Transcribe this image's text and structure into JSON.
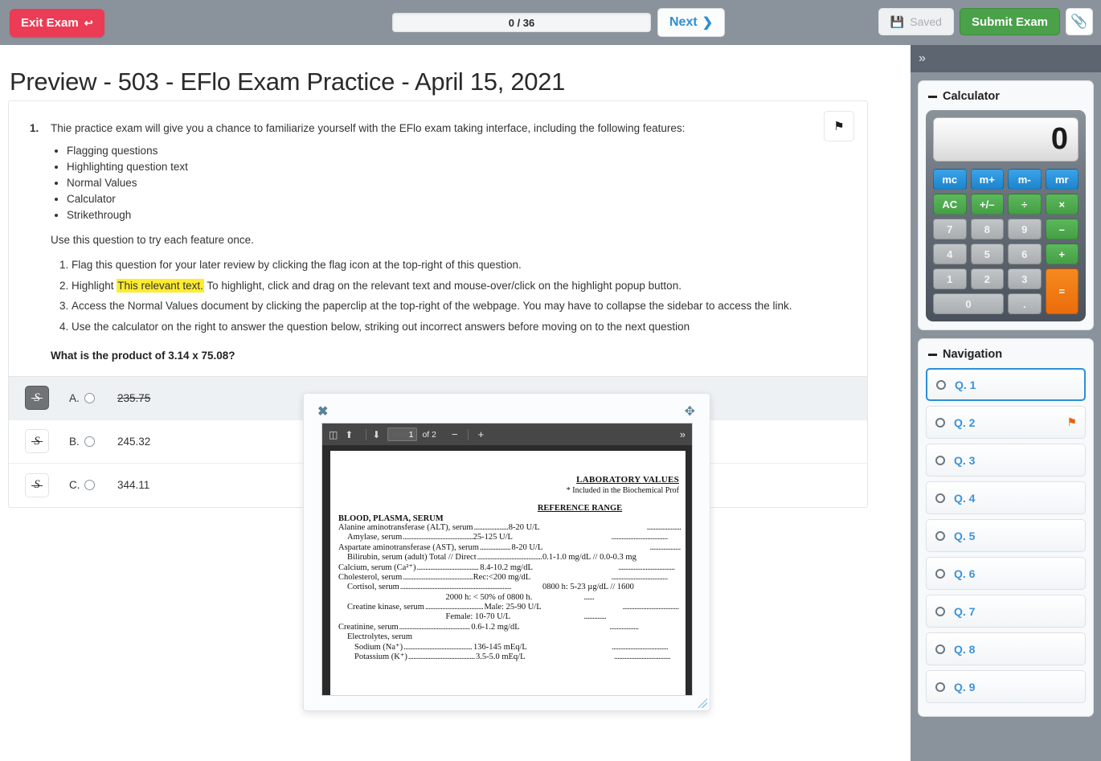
{
  "topbar": {
    "exit_label": "Exit Exam",
    "exit_icon": "exit-arrow-icon",
    "progress_text": "0 / 36",
    "next_label": "Next",
    "next_icon": "chevron-right-icon",
    "saved_label": "Saved",
    "save_icon": "floppy-disk-icon",
    "submit_label": "Submit Exam",
    "paperclip_icon": "paperclip-icon",
    "exit_color": "#ec3b55",
    "submit_color": "#4aa14a",
    "bar_color": "#8a939b"
  },
  "page": {
    "title": "Preview - 503 - EFlo Exam Practice - April 15, 2021"
  },
  "question": {
    "number": "1.",
    "stem": "Thie practice exam will give you a chance to familiarize yourself with the EFlo exam taking interface, including the following features:",
    "features": [
      "Flagging questions",
      "Highlighting question text",
      "Normal Values",
      "Calculator",
      "Strikethrough"
    ],
    "use_line": "Use this question to try each feature once.",
    "steps": [
      {
        "pre": "Flag this question for your later review by clicking the flag icon at the top-right of this question.",
        "highlight": "",
        "post": ""
      },
      {
        "pre": "Highlight ",
        "highlight": "This relevant text.",
        "post": " To highlight, click and drag on the relevant text and mouse-over/click on the highlight popup button."
      },
      {
        "pre": "Access the Normal Values document by clicking the paperclip at the top-right of the webpage. You may have to collapse the sidebar to access the link.",
        "highlight": "",
        "post": ""
      },
      {
        "pre": "Use the calculator on the right to answer the question below, striking out incorrect answers before moving on to the next question",
        "highlight": "",
        "post": ""
      }
    ],
    "prompt": "What is the product of 3.14 x 75.08?",
    "flag_icon": "flag-icon",
    "options": [
      {
        "letter": "A.",
        "value": "235.75",
        "struck": true
      },
      {
        "letter": "B.",
        "value": "245.32",
        "struck": false
      },
      {
        "letter": "C.",
        "value": "344.11",
        "struck": false
      }
    ],
    "strike_glyph": "S"
  },
  "sidebar": {
    "collapse_icon": "chevron-double-right-icon",
    "calculator": {
      "title": "Calculator",
      "display": "0",
      "memory_keys": [
        "mc",
        "m+",
        "m-",
        "mr"
      ],
      "op_keys": [
        "AC",
        "+/–",
        "÷",
        "×"
      ],
      "row1": [
        "7",
        "8",
        "9",
        "–"
      ],
      "row2": [
        "4",
        "5",
        "6",
        "+"
      ],
      "row3": [
        "1",
        "2",
        "3"
      ],
      "row4": [
        "0",
        "."
      ],
      "equals": "=",
      "colors": {
        "memory": "#2e97dd",
        "operator": "#5cb85c",
        "digit": "#b6babd",
        "equals": "#ee7010"
      }
    },
    "navigation": {
      "title": "Navigation",
      "items": [
        {
          "label": "Q. 1",
          "active": true,
          "flagged": false
        },
        {
          "label": "Q. 2",
          "active": false,
          "flagged": true
        },
        {
          "label": "Q. 3",
          "active": false,
          "flagged": false
        },
        {
          "label": "Q. 4",
          "active": false,
          "flagged": false
        },
        {
          "label": "Q. 5",
          "active": false,
          "flagged": false
        },
        {
          "label": "Q. 6",
          "active": false,
          "flagged": false
        },
        {
          "label": "Q. 7",
          "active": false,
          "flagged": false
        },
        {
          "label": "Q. 8",
          "active": false,
          "flagged": false
        },
        {
          "label": "Q. 9",
          "active": false,
          "flagged": false
        }
      ],
      "flag_icon": "flag-icon",
      "active_color": "#2c8fd8"
    }
  },
  "pdf_popup": {
    "close_icon": "close-icon",
    "move_icon": "move-handle-icon",
    "toolbar": {
      "sidebar_icon": "toggle-sidebar-icon",
      "up_icon": "arrow-up-icon",
      "down_icon": "arrow-down-icon",
      "page_number": "1",
      "page_total": "of 2",
      "zoom_out": "−",
      "zoom_in": "+",
      "more_icon": "chevron-double-right-icon"
    },
    "document": {
      "title": "LABORATORY VALUES",
      "subtitle": "*  Included in the Biochemical Prof",
      "reference_header": "REFERENCE RANGE",
      "section": "BLOOD, PLASMA, SERUM",
      "rows": [
        {
          "star": "*",
          "indent": 0,
          "name": "Alanine aminotransferase (ALT), serum",
          "value": "8-20 U/L"
        },
        {
          "star": "",
          "indent": 1,
          "name": "Amylase, serum",
          "value": "25-125 U/L"
        },
        {
          "star": "*",
          "indent": 0,
          "name": "Aspartate aminotransferase (AST), serum",
          "value": "8-20 U/L"
        },
        {
          "star": "",
          "indent": 1,
          "name": "Bilirubin, serum (adult) Total // Direct",
          "value": "0.1-1.0 mg/dL // 0.0-0.3 mg"
        },
        {
          "star": "*",
          "indent": 0,
          "name": "Calcium, serum (Ca²⁺)",
          "value": "8.4-10.2 mg/dL"
        },
        {
          "star": "*",
          "indent": 0,
          "name": "Cholesterol, serum",
          "value": "Rec:<200 mg/dL"
        },
        {
          "star": "",
          "indent": 1,
          "name": "Cortisol, serum",
          "value": "0800 h: 5-23 µg/dL // 1600"
        },
        {
          "star": "",
          "indent": 1,
          "name": "",
          "value": "2000 h: < 50% of 0800 h."
        },
        {
          "star": "",
          "indent": 1,
          "name": "Creatine kinase, serum",
          "value": "Male: 25-90 U/L"
        },
        {
          "star": "",
          "indent": 1,
          "name": "",
          "value": "Female: 10-70 U/L"
        },
        {
          "star": "*",
          "indent": 0,
          "name": "Creatinine, serum",
          "value": "0.6-1.2 mg/dL"
        },
        {
          "star": "",
          "indent": 1,
          "name": "Electrolytes, serum",
          "value": ""
        },
        {
          "star": "",
          "indent": 2,
          "name": "Sodium (Na⁺)",
          "value": "136-145 mEq/L"
        },
        {
          "star": "*",
          "indent": 2,
          "name": "Potassium (K⁺)",
          "value": "3.5-5.0 mEq/L"
        }
      ]
    },
    "resize_handle": "resize-handle-icon"
  }
}
